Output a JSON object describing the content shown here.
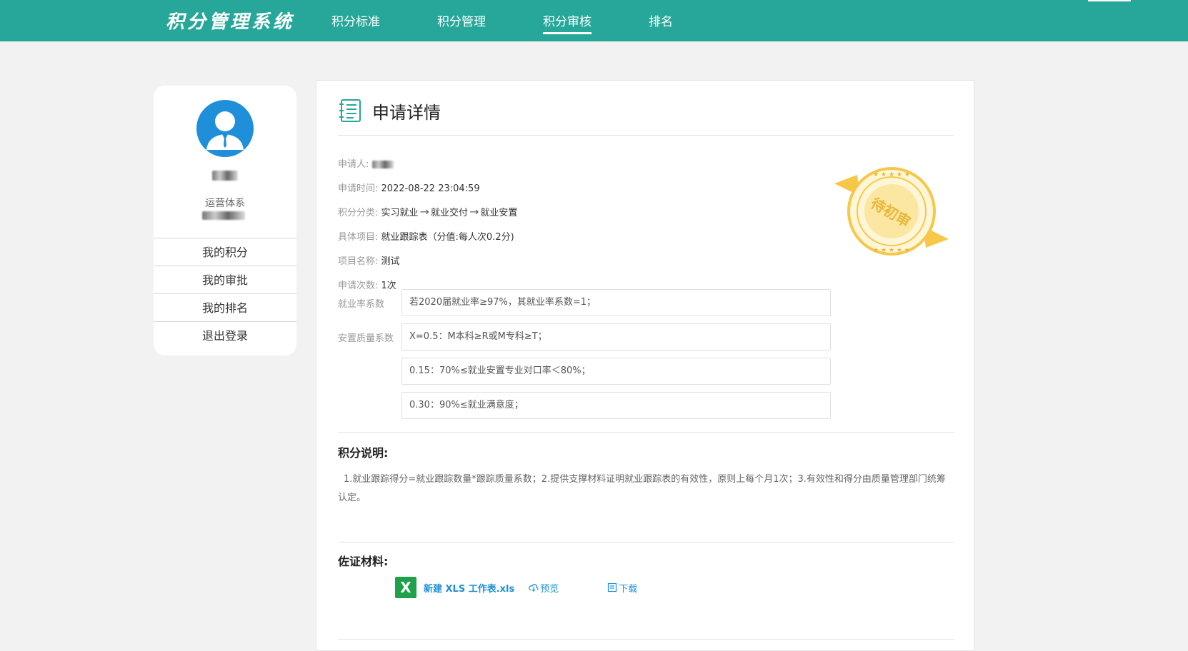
{
  "app": {
    "title": "积分管理系统"
  },
  "nav": [
    {
      "label": "积分标准",
      "active": false
    },
    {
      "label": "积分管理",
      "active": false
    },
    {
      "label": "积分审核",
      "active": true
    },
    {
      "label": "排名",
      "active": false
    }
  ],
  "sidebar": {
    "dept": "运营体系",
    "menu": [
      "我的积分",
      "我的审批",
      "我的排名",
      "退出登录"
    ]
  },
  "detail": {
    "title": "申请详情",
    "applicant_label": "申请人:",
    "time_label": "申请时间:",
    "time_value": "2022-08-22 23:04:59",
    "category_label": "积分分类:",
    "category_path": [
      "实习就业",
      "就业交付",
      "就业安置"
    ],
    "item_label": "具体项目:",
    "item_value": "就业跟踪表（分值:每人次0.2分)",
    "project_label": "项目名称:",
    "project_value": "测试",
    "count_label": "申请次数:",
    "count_value": "1次",
    "stamp_text": "待初审"
  },
  "coefficients": [
    {
      "label": "就业率系数",
      "value": "若2020届就业率≥97%，其就业率系数=1；"
    },
    {
      "label": "安置质量系数",
      "value": "X=0.5：M本科≥R或M专科≥T；"
    },
    {
      "label": "",
      "value": "0.15：70%≤就业安置专业对口率＜80%；"
    },
    {
      "label": "",
      "value": "0.30：90%≤就业满意度；"
    }
  ],
  "explain": {
    "heading": "积分说明:",
    "text": "1.就业跟踪得分=就业跟踪数量*跟踪质量系数；2.提供支撑材料证明就业跟踪表的有效性，原则上每个月1次；3.有效性和得分由质量管理部门统筹认定。"
  },
  "evidence": {
    "heading": "佐证材料:",
    "file_name": "新建 XLS 工作表.xls",
    "file_icon_letter": "X",
    "preview_label": "预览",
    "download_label": "下载"
  },
  "colors": {
    "brand": "#27a79a",
    "link": "#1d8fd8",
    "stamp": "#f5c84a"
  }
}
